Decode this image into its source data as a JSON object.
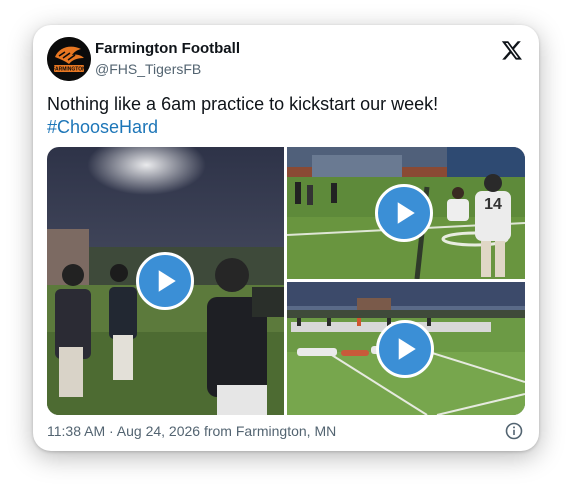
{
  "account": {
    "name": "Farmington Football",
    "handle": "@FHS_TigersFB",
    "avatar_label": "FARMINGTON"
  },
  "tweet": {
    "text": "Nothing like a 6am practice to kickstart our week!",
    "hashtag": "#ChooseHard"
  },
  "media": {
    "items": [
      {
        "kind": "video",
        "scene": "night practice, players running on field"
      },
      {
        "kind": "video",
        "scene": "players stretching, jersey 14"
      },
      {
        "kind": "video",
        "scene": "team stretching on field"
      }
    ],
    "jersey_number": "14"
  },
  "footer": {
    "timestamp": "11:38 AM · Aug 24, 2026 from Farmington, MN"
  },
  "icons": {
    "logo": "x-logo-icon",
    "play": "play-icon",
    "info": "info-icon"
  },
  "colors": {
    "link": "#1d76b8",
    "play_button": "#3b8fd6",
    "brand_orange": "#e87722"
  }
}
